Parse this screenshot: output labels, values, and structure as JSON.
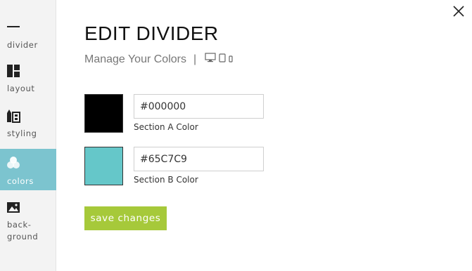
{
  "sidebar": {
    "items": [
      {
        "label": "divider",
        "icon": "divider-line-icon",
        "active": false
      },
      {
        "label": "layout",
        "icon": "layout-grid-icon",
        "active": false
      },
      {
        "label": "styling",
        "icon": "styling-brush-icon",
        "active": false
      },
      {
        "label": "colors",
        "icon": "colors-circles-icon",
        "active": true
      },
      {
        "label": "back-\nground",
        "icon": "background-image-icon",
        "active": false
      }
    ]
  },
  "header": {
    "title": "EDIT DIVIDER",
    "subtitle": "Manage Your Colors",
    "separator": "|",
    "device_icons": [
      "desktop-icon",
      "tablet-icon",
      "mobile-icon"
    ]
  },
  "colors": {
    "section_a": {
      "value": "#000000",
      "label": "Section A Color",
      "swatch": "#000000"
    },
    "section_b": {
      "value": "#65C7C9",
      "label": "Section B Color",
      "swatch": "#65C7C9"
    }
  },
  "actions": {
    "save_label": "save changes",
    "close_icon": "close-icon"
  },
  "theme": {
    "accent": "#7cc4cf",
    "save_button": "#a6c93a"
  }
}
